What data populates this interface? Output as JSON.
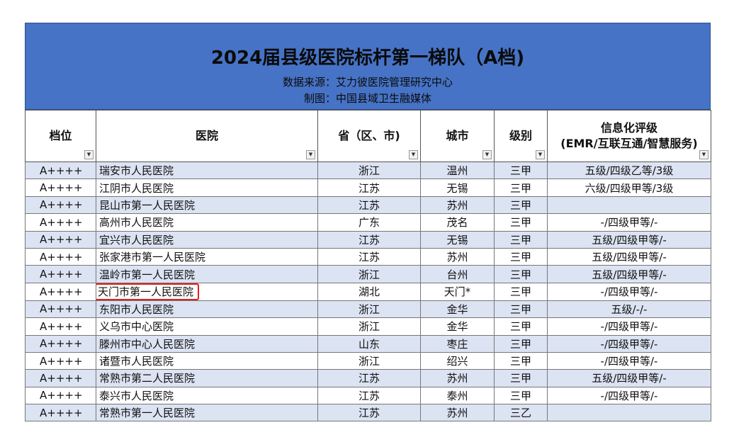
{
  "banner": {
    "title": "2024届县级医院标杆第一梯队（A档)",
    "source": "数据来源：艾力彼医院管理研究中心",
    "maker": "制图：中国县域卫生融媒体"
  },
  "colors": {
    "banner": "#4673c6",
    "row_stripe": "#dce3f3",
    "highlight": "#e0201b"
  },
  "columns": [
    "档位",
    "医院",
    "省（区、市)",
    "城市",
    "级别",
    "信息化评级\n(EMR/互联互通/智慧服务)"
  ],
  "rows": [
    [
      "A++++",
      "瑞安市人民医院",
      "浙江",
      "温州",
      "三甲",
      "五级/四级乙等/3级"
    ],
    [
      "A++++",
      "江阴市人民医院",
      "江苏",
      "无锡",
      "三甲",
      "六级/四级甲等/3级"
    ],
    [
      "A++++",
      "昆山市第一人民医院",
      "江苏",
      "苏州",
      "三甲",
      ""
    ],
    [
      "A++++",
      "高州市人民医院",
      "广东",
      "茂名",
      "三甲",
      "-/四级甲等/-"
    ],
    [
      "A++++",
      "宜兴市人民医院",
      "江苏",
      "无锡",
      "三甲",
      "五级/四级甲等/-"
    ],
    [
      "A++++",
      "张家港市第一人民医院",
      "江苏",
      "苏州",
      "三甲",
      "五级/四级甲等/-"
    ],
    [
      "A++++",
      "温岭市第一人民医院",
      "浙江",
      "台州",
      "三甲",
      "五级/四级甲等/-"
    ],
    [
      "A++++",
      "天门市第一人民医院",
      "湖北",
      "天门*",
      "三甲",
      "-/四级甲等/-"
    ],
    [
      "A++++",
      "东阳市人民医院",
      "浙江",
      "金华",
      "三甲",
      "五级/-/-"
    ],
    [
      "A++++",
      "义乌市中心医院",
      "浙江",
      "金华",
      "三甲",
      "-/四级甲等/-"
    ],
    [
      "A++++",
      "滕州市中心人民医院",
      "山东",
      "枣庄",
      "三甲",
      "-/四级甲等/-"
    ],
    [
      "A++++",
      "诸暨市人民医院",
      "浙江",
      "绍兴",
      "三甲",
      "-/四级甲等/-"
    ],
    [
      "A++++",
      "常熟市第二人民医院",
      "江苏",
      "苏州",
      "三甲",
      "五级/四级甲等/-"
    ],
    [
      "A++++",
      "泰兴市人民医院",
      "江苏",
      "泰州",
      "三甲",
      "-/四级甲等/-"
    ],
    [
      "A++++",
      "常熟市第一人民医院",
      "江苏",
      "苏州",
      "三乙",
      ""
    ]
  ],
  "highlighted_row": 7
}
